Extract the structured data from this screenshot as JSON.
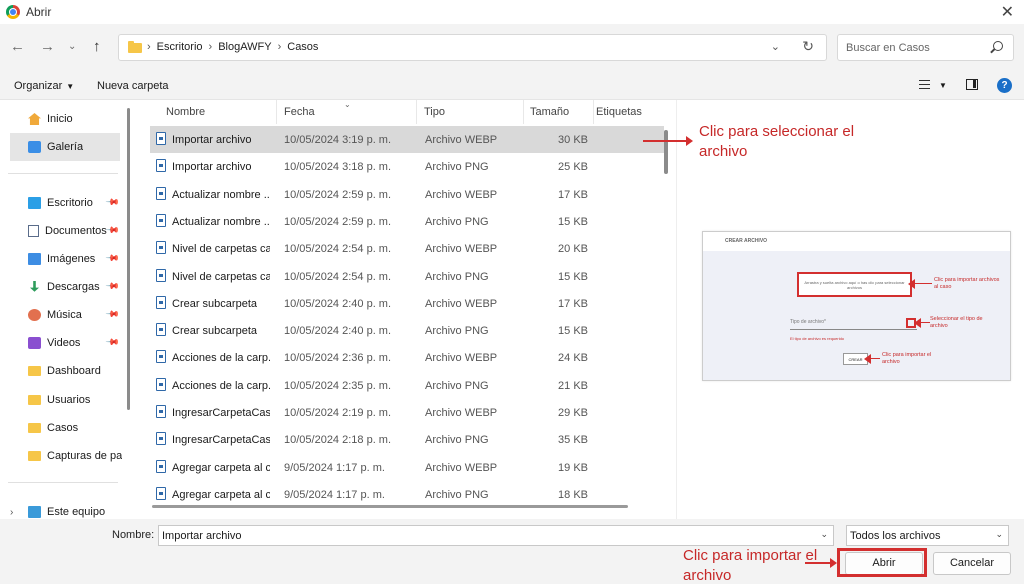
{
  "window": {
    "title": "Abrir"
  },
  "address": {
    "crumbs": [
      "Escritorio",
      "BlogAWFY",
      "Casos"
    ]
  },
  "search": {
    "placeholder": "Buscar en Casos"
  },
  "toolbar": {
    "organize": "Organizar",
    "new_folder": "Nueva carpeta"
  },
  "sidebar": {
    "items": [
      {
        "label": "Inicio",
        "icon": "home-icon"
      },
      {
        "label": "Galería",
        "icon": "gallery-icon"
      },
      {
        "label": "Escritorio",
        "icon": "desktop-icon"
      },
      {
        "label": "Documentos",
        "icon": "documents-icon"
      },
      {
        "label": "Imágenes",
        "icon": "images-icon"
      },
      {
        "label": "Descargas",
        "icon": "downloads-icon"
      },
      {
        "label": "Música",
        "icon": "music-icon"
      },
      {
        "label": "Videos",
        "icon": "videos-icon"
      },
      {
        "label": "Dashboard",
        "icon": "folder-icon"
      },
      {
        "label": "Usuarios",
        "icon": "folder-icon"
      },
      {
        "label": "Casos",
        "icon": "folder-icon"
      },
      {
        "label": "Capturas de par",
        "icon": "folder-icon"
      },
      {
        "label": "Este equipo",
        "icon": "computer-icon"
      }
    ]
  },
  "columns": {
    "name": "Nombre",
    "date": "Fecha",
    "type": "Tipo",
    "size": "Tamaño",
    "tags": "Etiquetas"
  },
  "files": [
    {
      "name": "Importar archivo",
      "date": "10/05/2024 3:19 p. m.",
      "type": "Archivo WEBP",
      "size": "30 KB"
    },
    {
      "name": "Importar archivo",
      "date": "10/05/2024 3:18 p. m.",
      "type": "Archivo PNG",
      "size": "25 KB"
    },
    {
      "name": "Actualizar nombre ...",
      "date": "10/05/2024 2:59 p. m.",
      "type": "Archivo WEBP",
      "size": "17 KB"
    },
    {
      "name": "Actualizar nombre ...",
      "date": "10/05/2024 2:59 p. m.",
      "type": "Archivo PNG",
      "size": "15 KB"
    },
    {
      "name": "Nivel de carpetas ca...",
      "date": "10/05/2024 2:54 p. m.",
      "type": "Archivo WEBP",
      "size": "20 KB"
    },
    {
      "name": "Nivel de carpetas ca...",
      "date": "10/05/2024 2:54 p. m.",
      "type": "Archivo PNG",
      "size": "15 KB"
    },
    {
      "name": "Crear subcarpeta",
      "date": "10/05/2024 2:40 p. m.",
      "type": "Archivo WEBP",
      "size": "17 KB"
    },
    {
      "name": "Crear subcarpeta",
      "date": "10/05/2024 2:40 p. m.",
      "type": "Archivo PNG",
      "size": "15 KB"
    },
    {
      "name": "Acciones de la carp...",
      "date": "10/05/2024 2:36 p. m.",
      "type": "Archivo WEBP",
      "size": "24 KB"
    },
    {
      "name": "Acciones de la carp...",
      "date": "10/05/2024 2:35 p. m.",
      "type": "Archivo PNG",
      "size": "21 KB"
    },
    {
      "name": "IngresarCarpetaCaso",
      "date": "10/05/2024 2:19 p. m.",
      "type": "Archivo WEBP",
      "size": "29 KB"
    },
    {
      "name": "IngresarCarpetaCaso",
      "date": "10/05/2024 2:18 p. m.",
      "type": "Archivo PNG",
      "size": "35 KB"
    },
    {
      "name": "Agregar carpeta al c...",
      "date": "9/05/2024 1:17 p. m.",
      "type": "Archivo WEBP",
      "size": "19 KB"
    },
    {
      "name": "Agregar carpeta al c...",
      "date": "9/05/2024 1:17 p. m.",
      "type": "Archivo PNG",
      "size": "18 KB"
    }
  ],
  "annotations": {
    "select": "Clic para seleccionar el archivo",
    "import": "Clic para importar el archivo"
  },
  "preview": {
    "title": "CREAR ARCHIVO",
    "dropzone": "Arrastra y suelta archivo aquí o has clic para seleccionar archivos",
    "note_import": "Clic para importar archivos al caso",
    "input_placeholder": "Tipo de archivo*",
    "note_select": "Seleccionar el tipo de archivo",
    "error": "El tipo de archivo es requerido",
    "create_button": "CREAR",
    "note_create": "Clic para importar el archivo"
  },
  "footer": {
    "name_label": "Nombre:",
    "name_value": "Importar archivo",
    "file_type": "Todos los archivos",
    "open": "Abrir",
    "cancel": "Cancelar"
  },
  "colors": {
    "accent": "#1a6fc8",
    "annotation": "#d32f2f",
    "selected_row": "#d9d9d9"
  }
}
